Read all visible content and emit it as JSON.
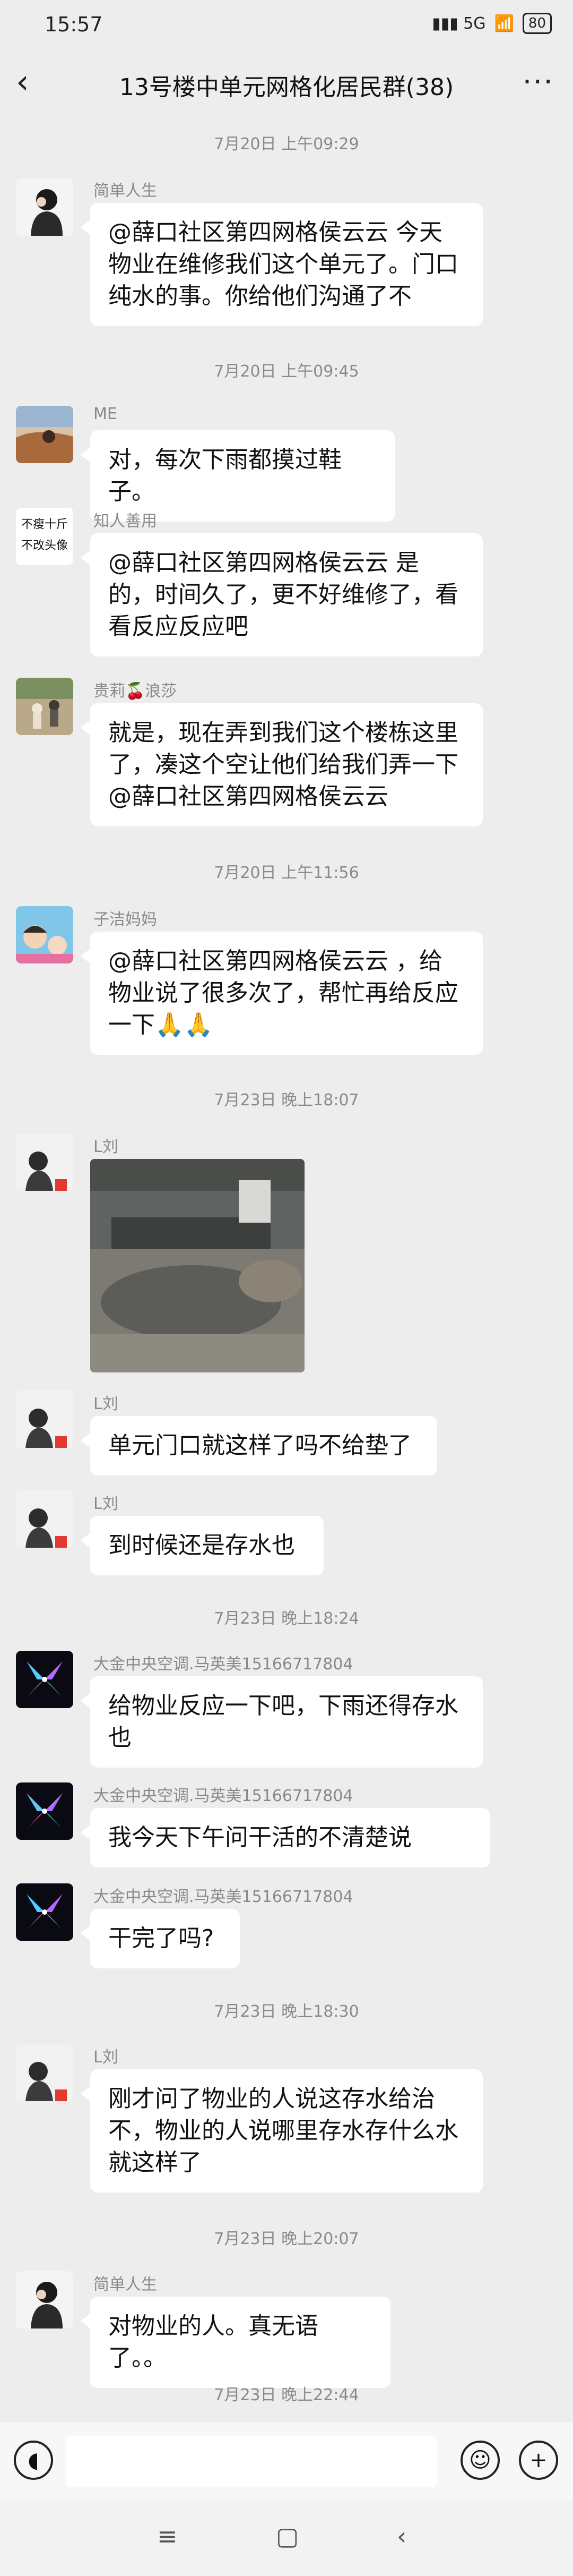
{
  "status": {
    "time": "15:57",
    "signal": "5G",
    "battery": "80"
  },
  "header": {
    "title": "13号楼中单元网格化居民群(38)"
  },
  "timestamps": [
    "7月20日 上午09:29",
    "7月20日 上午09:45",
    "7月20日 上午11:56",
    "7月23日 晚上18:07",
    "7月23日 晚上18:24",
    "7月23日 晚上18:30",
    "7月23日 晚上20:07",
    "7月23日 晚上22:44"
  ],
  "messages": [
    {
      "name": "简单人生",
      "text": "@薛口社区第四网格侯云云  今天物业在维修我们这个单元了。门口纯水的事。你给他们沟通了不"
    },
    {
      "name": "ME",
      "text": "对，每次下雨都摸过鞋子。"
    },
    {
      "name": "知人善用",
      "avatar_text": "不瘦十斤 不改头像",
      "text": "@薛口社区第四网格侯云云  是的，时间久了，更不好维修了，看看反应反应吧"
    },
    {
      "name": "贵莉🍒浪莎",
      "text": "就是，现在弄到我们这个楼栋这里了，凑这个空让他们给我们弄一下@薛口社区第四网格侯云云"
    },
    {
      "name": "子洁妈妈",
      "text": "@薛口社区第四网格侯云云 ，给物业说了很多次了，帮忙再给反应一下🙏🙏"
    },
    {
      "name": "L刘",
      "text": ""
    },
    {
      "name": "L刘",
      "text": "单元门口就这样了吗不给垫了"
    },
    {
      "name": "L刘",
      "text": "到时候还是存水也"
    },
    {
      "name": "大金中央空调.马英美15166717804",
      "text": "给物业反应一下吧，下雨还得存水也"
    },
    {
      "name": "大金中央空调.马英美15166717804",
      "text": "我今天下午问干活的不清楚说"
    },
    {
      "name": "大金中央空调.马英美15166717804",
      "text": "干完了吗?"
    },
    {
      "name": "L刘",
      "text": "刚才问了物业的人说这存水给治不，物业的人说哪里存水存什么水就这样了"
    },
    {
      "name": "简单人生",
      "text": "对物业的人。真无语了。。"
    }
  ]
}
